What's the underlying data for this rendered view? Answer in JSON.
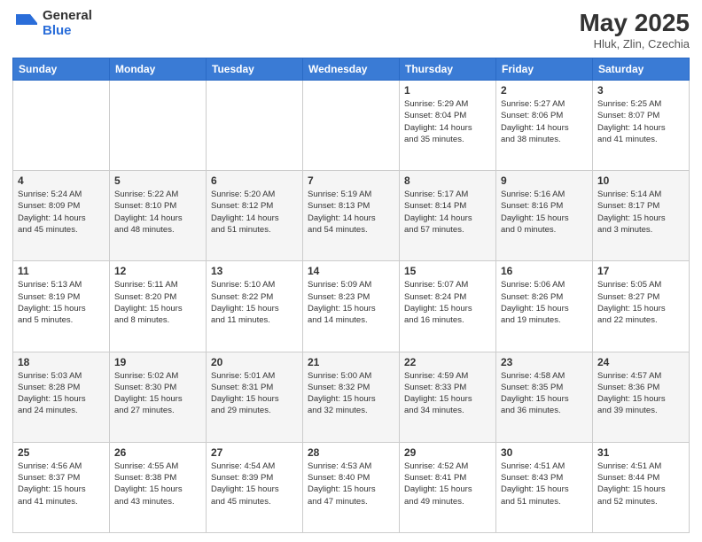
{
  "header": {
    "logo_general": "General",
    "logo_blue": "Blue",
    "month_title": "May 2025",
    "location": "Hluk, Zlin, Czechia"
  },
  "weekdays": [
    "Sunday",
    "Monday",
    "Tuesday",
    "Wednesday",
    "Thursday",
    "Friday",
    "Saturday"
  ],
  "weeks": [
    [
      {
        "day": "",
        "info": ""
      },
      {
        "day": "",
        "info": ""
      },
      {
        "day": "",
        "info": ""
      },
      {
        "day": "",
        "info": ""
      },
      {
        "day": "1",
        "info": "Sunrise: 5:29 AM\nSunset: 8:04 PM\nDaylight: 14 hours\nand 35 minutes."
      },
      {
        "day": "2",
        "info": "Sunrise: 5:27 AM\nSunset: 8:06 PM\nDaylight: 14 hours\nand 38 minutes."
      },
      {
        "day": "3",
        "info": "Sunrise: 5:25 AM\nSunset: 8:07 PM\nDaylight: 14 hours\nand 41 minutes."
      }
    ],
    [
      {
        "day": "4",
        "info": "Sunrise: 5:24 AM\nSunset: 8:09 PM\nDaylight: 14 hours\nand 45 minutes."
      },
      {
        "day": "5",
        "info": "Sunrise: 5:22 AM\nSunset: 8:10 PM\nDaylight: 14 hours\nand 48 minutes."
      },
      {
        "day": "6",
        "info": "Sunrise: 5:20 AM\nSunset: 8:12 PM\nDaylight: 14 hours\nand 51 minutes."
      },
      {
        "day": "7",
        "info": "Sunrise: 5:19 AM\nSunset: 8:13 PM\nDaylight: 14 hours\nand 54 minutes."
      },
      {
        "day": "8",
        "info": "Sunrise: 5:17 AM\nSunset: 8:14 PM\nDaylight: 14 hours\nand 57 minutes."
      },
      {
        "day": "9",
        "info": "Sunrise: 5:16 AM\nSunset: 8:16 PM\nDaylight: 15 hours\nand 0 minutes."
      },
      {
        "day": "10",
        "info": "Sunrise: 5:14 AM\nSunset: 8:17 PM\nDaylight: 15 hours\nand 3 minutes."
      }
    ],
    [
      {
        "day": "11",
        "info": "Sunrise: 5:13 AM\nSunset: 8:19 PM\nDaylight: 15 hours\nand 5 minutes."
      },
      {
        "day": "12",
        "info": "Sunrise: 5:11 AM\nSunset: 8:20 PM\nDaylight: 15 hours\nand 8 minutes."
      },
      {
        "day": "13",
        "info": "Sunrise: 5:10 AM\nSunset: 8:22 PM\nDaylight: 15 hours\nand 11 minutes."
      },
      {
        "day": "14",
        "info": "Sunrise: 5:09 AM\nSunset: 8:23 PM\nDaylight: 15 hours\nand 14 minutes."
      },
      {
        "day": "15",
        "info": "Sunrise: 5:07 AM\nSunset: 8:24 PM\nDaylight: 15 hours\nand 16 minutes."
      },
      {
        "day": "16",
        "info": "Sunrise: 5:06 AM\nSunset: 8:26 PM\nDaylight: 15 hours\nand 19 minutes."
      },
      {
        "day": "17",
        "info": "Sunrise: 5:05 AM\nSunset: 8:27 PM\nDaylight: 15 hours\nand 22 minutes."
      }
    ],
    [
      {
        "day": "18",
        "info": "Sunrise: 5:03 AM\nSunset: 8:28 PM\nDaylight: 15 hours\nand 24 minutes."
      },
      {
        "day": "19",
        "info": "Sunrise: 5:02 AM\nSunset: 8:30 PM\nDaylight: 15 hours\nand 27 minutes."
      },
      {
        "day": "20",
        "info": "Sunrise: 5:01 AM\nSunset: 8:31 PM\nDaylight: 15 hours\nand 29 minutes."
      },
      {
        "day": "21",
        "info": "Sunrise: 5:00 AM\nSunset: 8:32 PM\nDaylight: 15 hours\nand 32 minutes."
      },
      {
        "day": "22",
        "info": "Sunrise: 4:59 AM\nSunset: 8:33 PM\nDaylight: 15 hours\nand 34 minutes."
      },
      {
        "day": "23",
        "info": "Sunrise: 4:58 AM\nSunset: 8:35 PM\nDaylight: 15 hours\nand 36 minutes."
      },
      {
        "day": "24",
        "info": "Sunrise: 4:57 AM\nSunset: 8:36 PM\nDaylight: 15 hours\nand 39 minutes."
      }
    ],
    [
      {
        "day": "25",
        "info": "Sunrise: 4:56 AM\nSunset: 8:37 PM\nDaylight: 15 hours\nand 41 minutes."
      },
      {
        "day": "26",
        "info": "Sunrise: 4:55 AM\nSunset: 8:38 PM\nDaylight: 15 hours\nand 43 minutes."
      },
      {
        "day": "27",
        "info": "Sunrise: 4:54 AM\nSunset: 8:39 PM\nDaylight: 15 hours\nand 45 minutes."
      },
      {
        "day": "28",
        "info": "Sunrise: 4:53 AM\nSunset: 8:40 PM\nDaylight: 15 hours\nand 47 minutes."
      },
      {
        "day": "29",
        "info": "Sunrise: 4:52 AM\nSunset: 8:41 PM\nDaylight: 15 hours\nand 49 minutes."
      },
      {
        "day": "30",
        "info": "Sunrise: 4:51 AM\nSunset: 8:43 PM\nDaylight: 15 hours\nand 51 minutes."
      },
      {
        "day": "31",
        "info": "Sunrise: 4:51 AM\nSunset: 8:44 PM\nDaylight: 15 hours\nand 52 minutes."
      }
    ]
  ]
}
